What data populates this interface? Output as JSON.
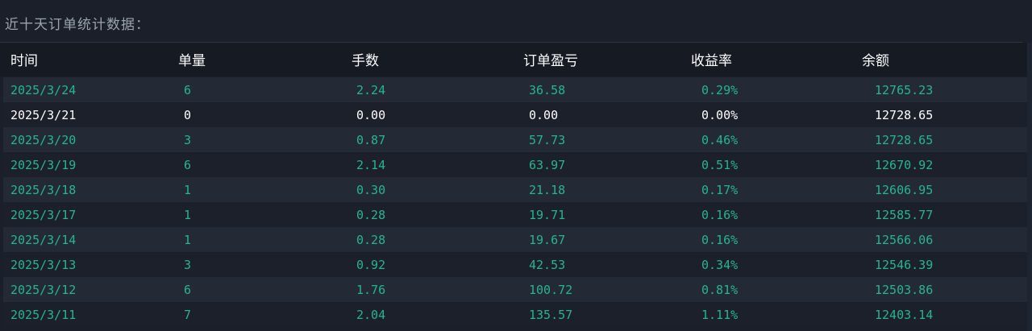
{
  "title": "近十天订单统计数据：",
  "table": {
    "headers": [
      "时间",
      "单量",
      "手数",
      "订单盈亏",
      "收益率",
      "余额"
    ],
    "rows": [
      [
        "2025/3/24",
        "6",
        "2.24",
        "36.58",
        "0.29%",
        "12765.23"
      ],
      [
        "2025/3/21",
        "0",
        "0.00",
        "0.00",
        "0.00%",
        "12728.65"
      ],
      [
        "2025/3/20",
        "3",
        "0.87",
        "57.73",
        "0.46%",
        "12728.65"
      ],
      [
        "2025/3/19",
        "6",
        "2.14",
        "63.97",
        "0.51%",
        "12670.92"
      ],
      [
        "2025/3/18",
        "1",
        "0.30",
        "21.18",
        "0.17%",
        "12606.95"
      ],
      [
        "2025/3/17",
        "1",
        "0.28",
        "19.71",
        "0.16%",
        "12585.77"
      ],
      [
        "2025/3/14",
        "1",
        "0.28",
        "19.67",
        "0.16%",
        "12566.06"
      ],
      [
        "2025/3/13",
        "3",
        "0.92",
        "42.53",
        "0.34%",
        "12546.39"
      ],
      [
        "2025/3/12",
        "6",
        "1.76",
        "100.72",
        "0.81%",
        "12503.86"
      ],
      [
        "2025/3/11",
        "7",
        "2.04",
        "135.57",
        "1.11%",
        "12403.14"
      ]
    ]
  },
  "colors": {
    "positive": "#26b58f",
    "neutral": "#ffffff"
  }
}
